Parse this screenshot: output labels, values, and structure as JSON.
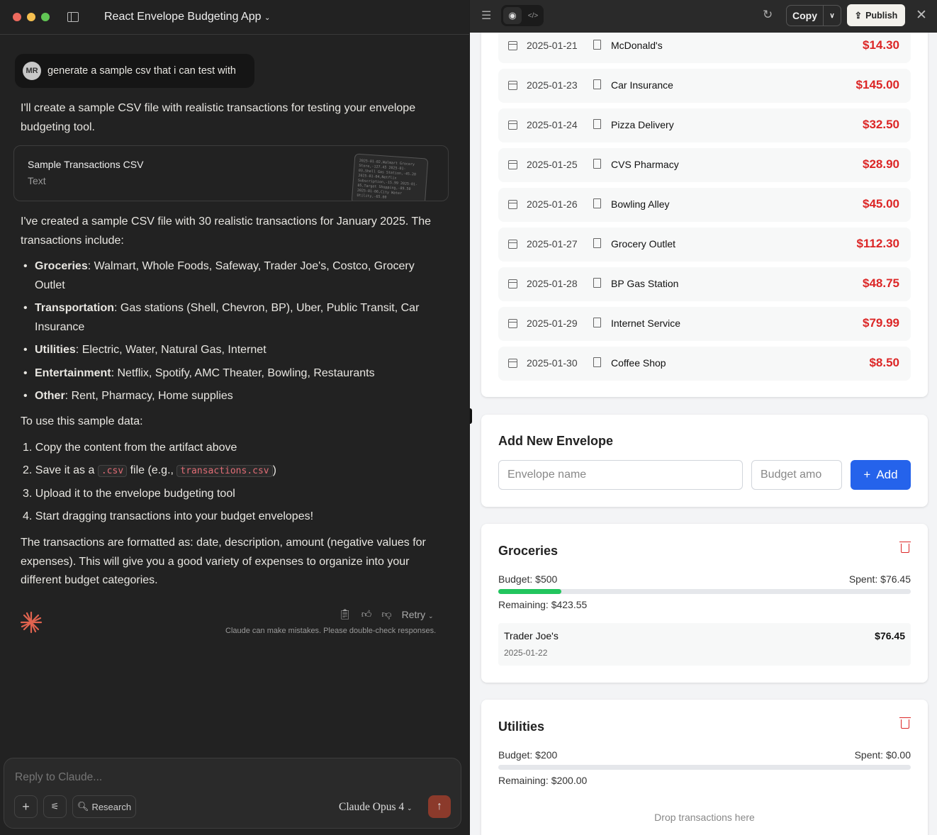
{
  "window": {
    "title": "React Envelope Budgeting App"
  },
  "chat": {
    "user": {
      "initials": "MR",
      "message": "generate a sample csv that i can test with"
    },
    "intro": "I'll create a sample CSV file with realistic transactions for testing your envelope budgeting tool.",
    "artifact": {
      "title": "Sample Transactions CSV",
      "type": "Text",
      "preview": "2025-01-02,Walmart Grocery Store,-127.45 2025-01-03,Shell Gas Station,-45.20 2025-01-04,Netflix Subscription,-15.99 2025-01-05,Target Shopping,-89.50 2025-01-06,City Water Utility,-65.00"
    },
    "summary": "I've created a sample CSV file with 30 realistic transactions for January 2025. The transactions include:",
    "categories": [
      {
        "name": "Groceries",
        "text": ": Walmart, Whole Foods, Safeway, Trader Joe's, Costco, Grocery Outlet"
      },
      {
        "name": "Transportation",
        "text": ": Gas stations (Shell, Chevron, BP), Uber, Public Transit, Car Insurance"
      },
      {
        "name": "Utilities",
        "text": ": Electric, Water, Natural Gas, Internet"
      },
      {
        "name": "Entertainment",
        "text": ": Netflix, Spotify, AMC Theater, Bowling, Restaurants"
      },
      {
        "name": "Other",
        "text": ": Rent, Pharmacy, Home supplies"
      }
    ],
    "usage_intro": "To use this sample data:",
    "steps": {
      "s1": "1. Copy the content from the artifact above",
      "s2a": "2. Save it as a ",
      "s2code1": ".csv",
      "s2b": " file (e.g., ",
      "s2code2": "transactions.csv",
      "s2c": ")",
      "s3": "3. Upload it to the envelope budgeting tool",
      "s4": "4. Start dragging transactions into your budget envelopes!"
    },
    "closing": "The transactions are formatted as: date, description, amount (negative values for expenses). This will give you a good variety of expenses to organize into your different budget categories.",
    "retry": "Retry",
    "disclaimer": "Claude can make mistakes. Please double-check responses.",
    "composer": {
      "placeholder": "Reply to Claude...",
      "research": "Research",
      "model": "Claude Opus 4"
    }
  },
  "artifact_panel": {
    "copy": "Copy",
    "publish": "Publish",
    "transactions": [
      {
        "date": "2025-01-21",
        "desc": "McDonald's",
        "amount": "$14.30"
      },
      {
        "date": "2025-01-23",
        "desc": "Car Insurance",
        "amount": "$145.00"
      },
      {
        "date": "2025-01-24",
        "desc": "Pizza Delivery",
        "amount": "$32.50"
      },
      {
        "date": "2025-01-25",
        "desc": "CVS Pharmacy",
        "amount": "$28.90"
      },
      {
        "date": "2025-01-26",
        "desc": "Bowling Alley",
        "amount": "$45.00"
      },
      {
        "date": "2025-01-27",
        "desc": "Grocery Outlet",
        "amount": "$112.30"
      },
      {
        "date": "2025-01-28",
        "desc": "BP Gas Station",
        "amount": "$48.75"
      },
      {
        "date": "2025-01-29",
        "desc": "Internet Service",
        "amount": "$79.99"
      },
      {
        "date": "2025-01-30",
        "desc": "Coffee Shop",
        "amount": "$8.50"
      }
    ],
    "add_envelope": {
      "title": "Add New Envelope",
      "name_placeholder": "Envelope name",
      "budget_placeholder": "Budget amo",
      "add": "Add"
    },
    "envelopes": [
      {
        "name": "Groceries",
        "budget": "Budget: $500",
        "spent": "Spent: $76.45",
        "remaining": "Remaining: $423.55",
        "progress_percent": 15.29,
        "items": [
          {
            "desc": "Trader Joe's",
            "amount": "$76.45",
            "date": "2025-01-22"
          }
        ]
      },
      {
        "name": "Utilities",
        "budget": "Budget: $200",
        "spent": "Spent: $0.00",
        "remaining": "Remaining: $200.00",
        "progress_percent": 0,
        "drop_hint": "Drop transactions here"
      }
    ],
    "colors": {
      "negative": "#dc2626",
      "progress": "#22c55e",
      "primary": "#2563eb"
    }
  }
}
